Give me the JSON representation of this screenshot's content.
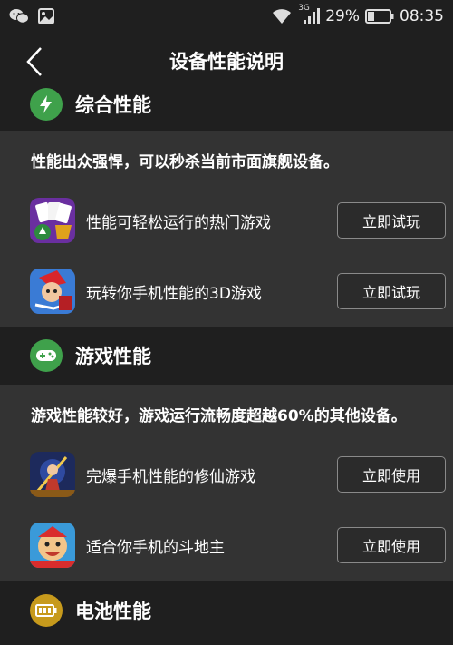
{
  "status_bar": {
    "network": "3G",
    "battery": "29%",
    "time": "08:35"
  },
  "header": {
    "title": "设备性能说明"
  },
  "sections": [
    {
      "title": "综合性能",
      "icon": "lightning-icon",
      "color": "#3fa14b",
      "description": "性能出众强悍，可以秒杀当前市面旗舰设备。",
      "items": [
        {
          "label": "性能可轻松运行的热门游戏",
          "button": "立即试玩",
          "icon": "poker-game-icon"
        },
        {
          "label": "玩转你手机性能的3D游戏",
          "button": "立即试玩",
          "icon": "3d-hero-game-icon"
        }
      ]
    },
    {
      "title": "游戏性能",
      "icon": "gamepad-icon",
      "color": "#3fa14b",
      "description": "游戏性能较好，游戏运行流畅度超越60%的其他设备。",
      "items": [
        {
          "label": "完爆手机性能的修仙游戏",
          "button": "立即使用",
          "icon": "xianxia-game-icon"
        },
        {
          "label": "适合你手机的斗地主",
          "button": "立即使用",
          "icon": "doudizhu-game-icon"
        }
      ]
    },
    {
      "title": "电池性能",
      "icon": "battery-icon",
      "color": "#c79a1c"
    }
  ]
}
